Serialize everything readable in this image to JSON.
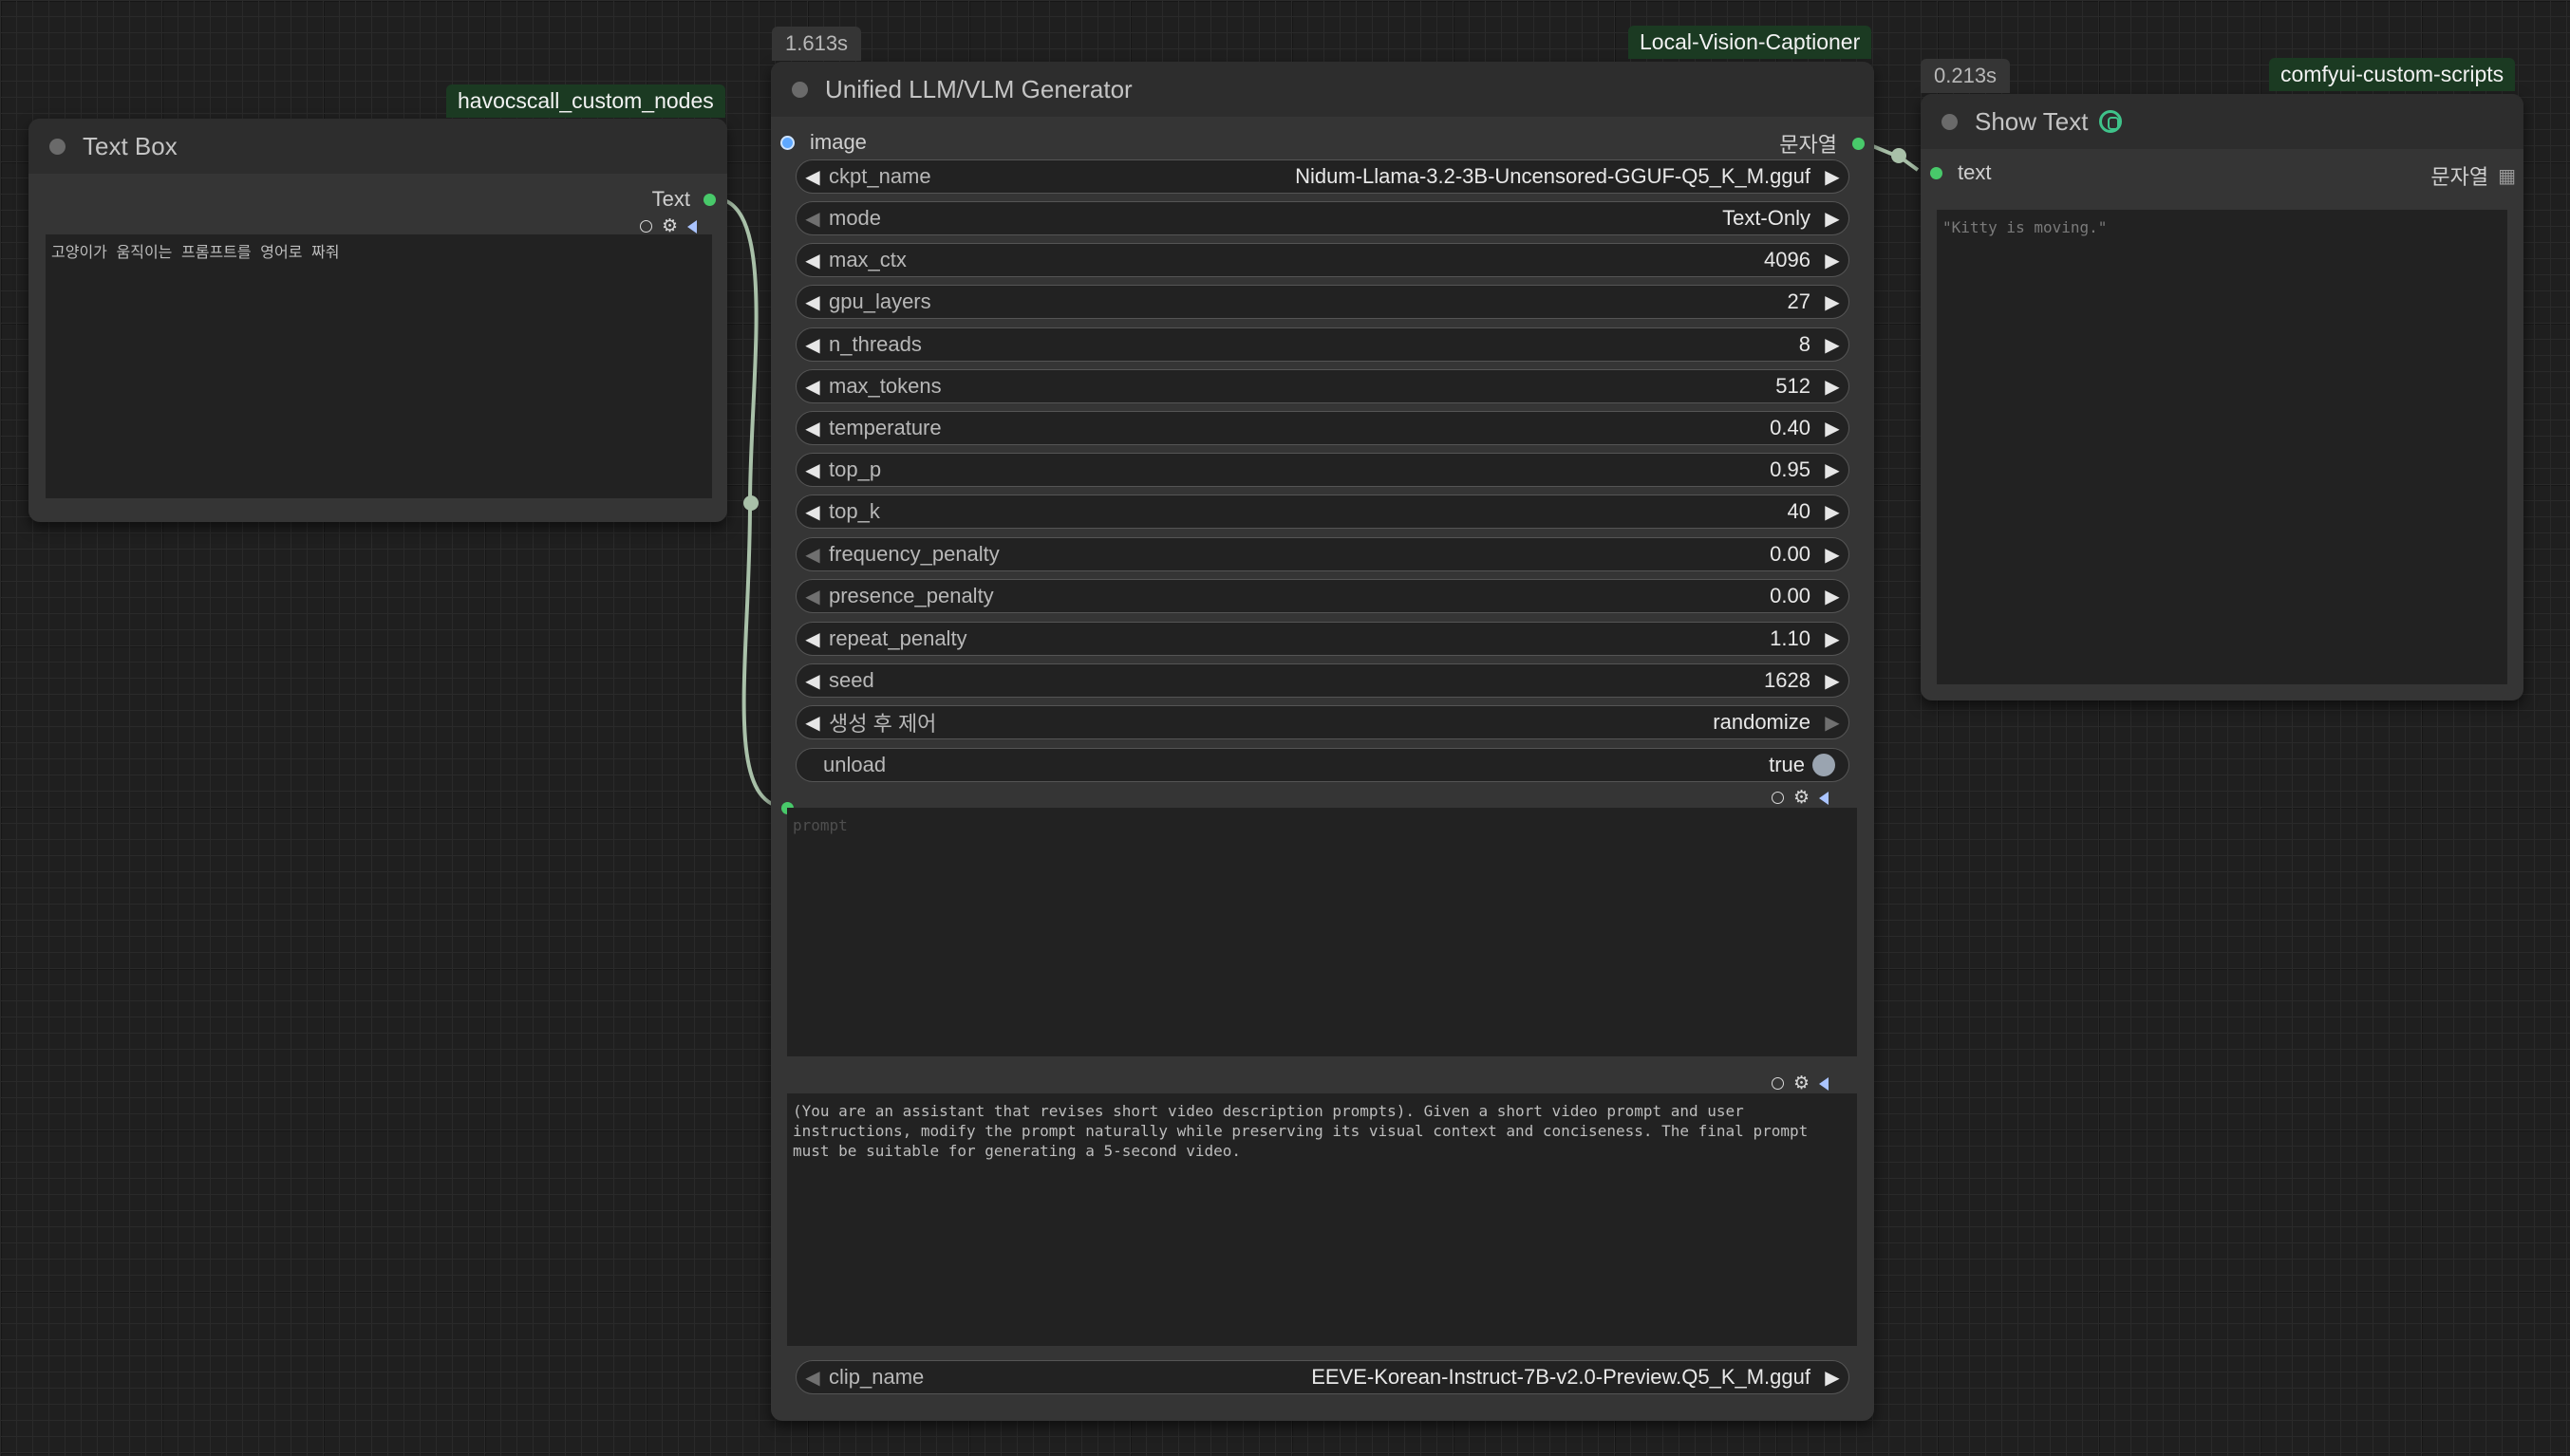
{
  "text_box_node": {
    "badge": "havocscall_custom_nodes",
    "title": "Text Box",
    "output_label": "Text",
    "text": "고양이가 움직이는 프롬프트를 영어로 짜줘"
  },
  "generator_node": {
    "timing": "1.613s",
    "badge": "Local-Vision-Captioner",
    "title": "Unified LLM/VLM Generator",
    "input_image_label": "image",
    "output_label": "문자열",
    "widgets": [
      {
        "label": "ckpt_name",
        "value": "Nidum-Llama-3.2-3B-Uncensored-GGUF-Q5_K_M.gguf"
      },
      {
        "label": "mode",
        "value": "Text-Only"
      },
      {
        "label": "max_ctx",
        "value": "4096"
      },
      {
        "label": "gpu_layers",
        "value": "27"
      },
      {
        "label": "n_threads",
        "value": "8"
      },
      {
        "label": "max_tokens",
        "value": "512"
      },
      {
        "label": "temperature",
        "value": "0.40"
      },
      {
        "label": "top_p",
        "value": "0.95"
      },
      {
        "label": "top_k",
        "value": "40"
      },
      {
        "label": "frequency_penalty",
        "value": "0.00"
      },
      {
        "label": "presence_penalty",
        "value": "0.00"
      },
      {
        "label": "repeat_penalty",
        "value": "1.10"
      },
      {
        "label": "seed",
        "value": "1628"
      },
      {
        "label": "생성 후 제어",
        "value": "randomize"
      }
    ],
    "unload": {
      "label": "unload",
      "value": "true"
    },
    "prompt_placeholder": "prompt",
    "system_prompt": "(You are an assistant that revises short video description prompts). Given a short video prompt and user instructions, modify the prompt naturally while preserving its visual context and conciseness. The final prompt must be suitable for generating a 5-second video.",
    "clip_name": {
      "label": "clip_name",
      "value": "EEVE-Korean-Instruct-7B-v2.0-Preview.Q5_K_M.gguf"
    }
  },
  "show_text_node": {
    "timing": "0.213s",
    "badge": "comfyui-custom-scripts",
    "title": "Show Text",
    "input_label": "text",
    "output_label": "문자열",
    "text": "\"Kitty is moving.\""
  },
  "icons": {
    "title_dot": "collapse-dot-icon",
    "show_text_logo": "pysssss-snake-icon",
    "widget_options": [
      "circle-icon",
      "gear-icon",
      "speaker-icon"
    ],
    "list_output": "grid-icon"
  }
}
